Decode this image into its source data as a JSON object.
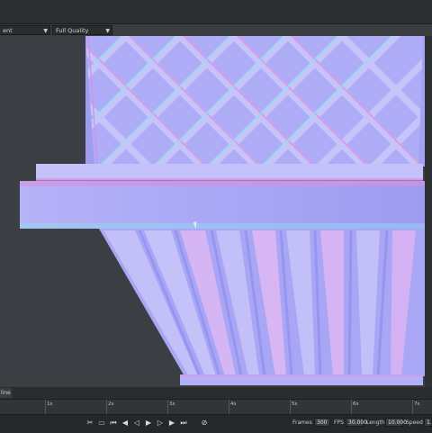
{
  "toolbar": {
    "shading_mode": "ent",
    "quality": "Full Quality"
  },
  "timeline": {
    "label": "line",
    "ticks": [
      "1s",
      "2s",
      "3s",
      "4s",
      "5s",
      "6s",
      "7s"
    ]
  },
  "playback": {
    "frames_label": "Frames",
    "frames_value": "300",
    "fps_label": "FPS",
    "fps_value": "30.000",
    "length_label": "Length",
    "length_value": "10.000",
    "speed_label": "Speed",
    "speed_value": "1.00"
  },
  "colors": {
    "normal_map_base": "#a9a6f6",
    "normal_map_pink": "#d98bd9",
    "normal_map_cyan": "#9fe3f0"
  }
}
